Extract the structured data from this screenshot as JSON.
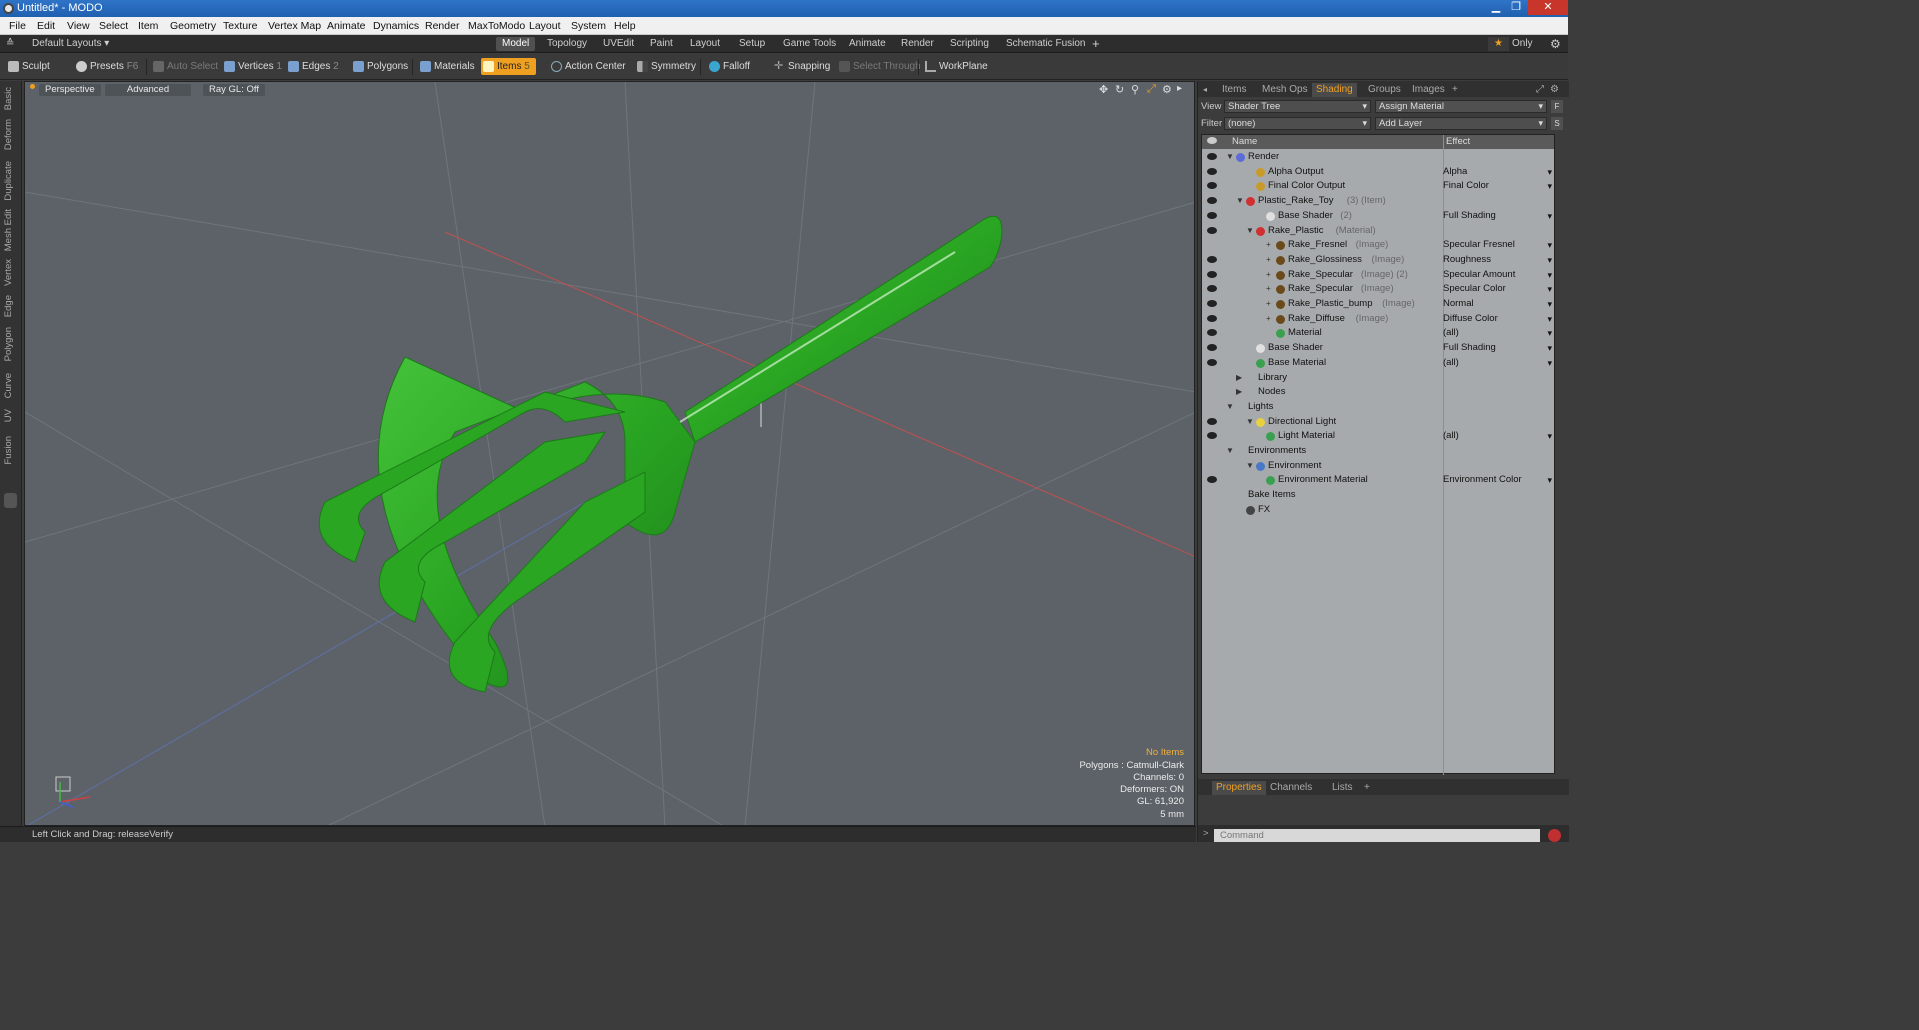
{
  "window": {
    "title": "Untitled* - MODO"
  },
  "menu": [
    "File",
    "Edit",
    "View",
    "Select",
    "Item",
    "Geometry",
    "Texture",
    "Vertex Map",
    "Animate",
    "Dynamics",
    "Render",
    "MaxToModo",
    "Layout",
    "System",
    "Help"
  ],
  "layouts": {
    "selector": "Default Layouts ▾",
    "tabs": [
      "Model",
      "Topology",
      "UVEdit",
      "Paint",
      "Layout",
      "Setup",
      "Game Tools",
      "Animate",
      "Render",
      "Scripting",
      "Schematic Fusion"
    ],
    "active": "Model",
    "plus": "+",
    "only": "Only"
  },
  "toolbar": {
    "sculpt": "Sculpt",
    "presets": "Presets",
    "presets_key": "F6",
    "auto_select": "Auto Select",
    "vertices": "Vertices",
    "vertices_key": "1",
    "edges": "Edges",
    "edges_key": "2",
    "polygons": "Polygons",
    "materials": "Materials",
    "items": "Items",
    "items_key": "5",
    "action_center": "Action Center",
    "symmetry": "Symmetry",
    "falloff": "Falloff",
    "snapping": "Snapping",
    "select_through": "Select Through",
    "workplane": "WorkPlane"
  },
  "left_tabs": [
    "Basic",
    "Deform",
    "Duplicate",
    "Mesh Edit",
    "Vertex",
    "Edge",
    "Polygon",
    "Curve",
    "UV",
    "Fusion"
  ],
  "viewport": {
    "perspective": "Perspective",
    "advanced": "Advanced",
    "raygl": "Ray GL: Off",
    "info": {
      "items": "No Items",
      "polygons": "Polygons : Catmull-Clark",
      "channels": "Channels: 0",
      "deformers": "Deformers: ON",
      "gl": "GL: 61,920",
      "scale": "5 mm"
    }
  },
  "status": {
    "hint": "Left Click and Drag:  releaseVerify"
  },
  "right_panel": {
    "tabs": [
      "Items",
      "Mesh Ops",
      "Shading",
      "Groups",
      "Images",
      "+"
    ],
    "active_tab": "Shading",
    "view_label": "View",
    "view_value": "Shader Tree",
    "assign": "Assign Material",
    "filter_label": "Filter",
    "filter_value": "(none)",
    "add_layer": "Add Layer",
    "col_name": "Name",
    "col_effect": "Effect",
    "rows": [
      {
        "name": "Render",
        "sub": "",
        "effect": "",
        "indent": 1,
        "color": "#5b6bd8",
        "toggle": "▼",
        "eye": true
      },
      {
        "name": "Alpha Output",
        "sub": "",
        "effect": "Alpha",
        "indent": 3,
        "color": "#c89a2a",
        "toggle": "",
        "eye": true
      },
      {
        "name": "Final Color Output",
        "sub": "",
        "effect": "Final Color",
        "indent": 3,
        "color": "#c89a2a",
        "toggle": "",
        "eye": true
      },
      {
        "name": "Plastic_Rake_Toy",
        "sub": "(3) (Item)",
        "effect": "",
        "indent": 2,
        "color": "#d03030",
        "toggle": "▼",
        "eye": true
      },
      {
        "name": "Base Shader",
        "sub": "(2)",
        "effect": "Full Shading",
        "indent": 4,
        "color": "#e0e0e0",
        "toggle": "",
        "eye": true
      },
      {
        "name": "Rake_Plastic",
        "sub": "(Material)",
        "effect": "",
        "indent": 3,
        "color": "#d03030",
        "toggle": "▼",
        "eye": true
      },
      {
        "name": "Rake_Fresnel",
        "sub": "(Image)",
        "effect": "Specular Fresnel",
        "indent": 5,
        "color": "#6a4a1a",
        "toggle": "+",
        "eye": false
      },
      {
        "name": "Rake_Glossiness",
        "sub": "(Image)",
        "effect": "Roughness",
        "indent": 5,
        "color": "#6a4a1a",
        "toggle": "+",
        "eye": true
      },
      {
        "name": "Rake_Specular",
        "sub": "(Image) (2)",
        "effect": "Specular Amount",
        "indent": 5,
        "color": "#6a4a1a",
        "toggle": "+",
        "eye": true
      },
      {
        "name": "Rake_Specular",
        "sub": "(Image)",
        "effect": "Specular Color",
        "indent": 5,
        "color": "#6a4a1a",
        "toggle": "+",
        "eye": true
      },
      {
        "name": "Rake_Plastic_bump",
        "sub": "(Image)",
        "effect": "Normal",
        "indent": 5,
        "color": "#6a4a1a",
        "toggle": "+",
        "eye": true
      },
      {
        "name": "Rake_Diffuse",
        "sub": "(Image)",
        "effect": "Diffuse Color",
        "indent": 5,
        "color": "#6a4a1a",
        "toggle": "+",
        "eye": true
      },
      {
        "name": "Material",
        "sub": "",
        "effect": "(all)",
        "indent": 5,
        "color": "#3aa050",
        "toggle": "",
        "eye": true
      },
      {
        "name": "Base Shader",
        "sub": "",
        "effect": "Full Shading",
        "indent": 3,
        "color": "#e0e0e0",
        "toggle": "",
        "eye": true
      },
      {
        "name": "Base Material",
        "sub": "",
        "effect": "(all)",
        "indent": 3,
        "color": "#3aa050",
        "toggle": "",
        "eye": true
      },
      {
        "name": "Library",
        "sub": "",
        "effect": "",
        "indent": 2,
        "color": "",
        "toggle": "▶",
        "eye": false
      },
      {
        "name": "Nodes",
        "sub": "",
        "effect": "",
        "indent": 2,
        "color": "",
        "toggle": "▶",
        "eye": false
      },
      {
        "name": "Lights",
        "sub": "",
        "effect": "",
        "indent": 1,
        "color": "",
        "toggle": "▼",
        "eye": false
      },
      {
        "name": "Directional Light",
        "sub": "",
        "effect": "",
        "indent": 3,
        "color": "#e8d040",
        "toggle": "▼",
        "eye": true
      },
      {
        "name": "Light Material",
        "sub": "",
        "effect": "(all)",
        "indent": 4,
        "color": "#3aa050",
        "toggle": "",
        "eye": true
      },
      {
        "name": "Environments",
        "sub": "",
        "effect": "",
        "indent": 1,
        "color": "",
        "toggle": "▼",
        "eye": false
      },
      {
        "name": "Environment",
        "sub": "",
        "effect": "",
        "indent": 3,
        "color": "#4a78c8",
        "toggle": "▼",
        "eye": false
      },
      {
        "name": "Environment Material",
        "sub": "",
        "effect": "Environment Color",
        "indent": 4,
        "color": "#3aa050",
        "toggle": "",
        "eye": true
      },
      {
        "name": "Bake Items",
        "sub": "",
        "effect": "",
        "indent": 1,
        "color": "",
        "toggle": "",
        "eye": false
      },
      {
        "name": "FX",
        "sub": "",
        "effect": "",
        "indent": 2,
        "color": "#444",
        "toggle": "",
        "eye": false
      }
    ],
    "bottom_tabs": [
      "Properties",
      "Channels",
      "Lists",
      "+"
    ],
    "bottom_active": "Properties",
    "command_placeholder": "Command",
    "cmd_prompt": ">"
  },
  "colors": {
    "accent": "#f0a020",
    "model": "#2fa82a"
  }
}
